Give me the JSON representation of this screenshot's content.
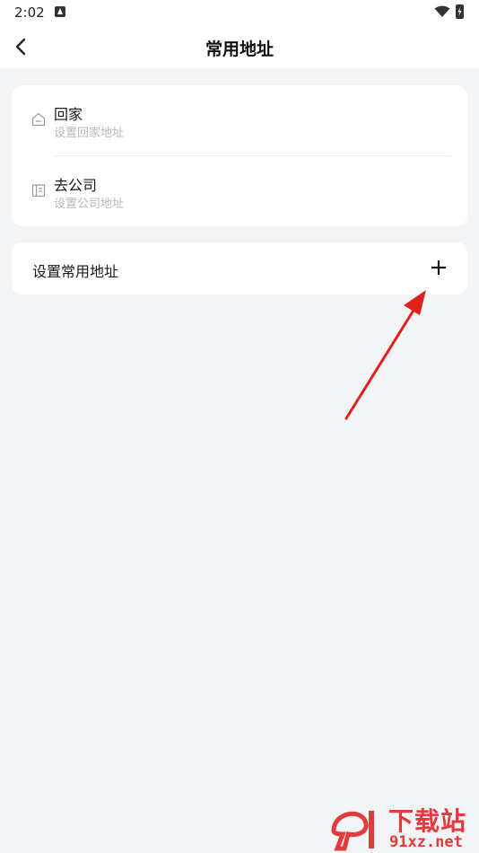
{
  "status_bar": {
    "time": "2:02",
    "notification_icon": "a-square-icon",
    "wifi_icon": "wifi-icon",
    "battery_icon": "battery-charging-icon"
  },
  "header": {
    "title": "常用地址",
    "back_icon": "chevron-left-icon"
  },
  "addresses": [
    {
      "title": "回家",
      "subtitle": "设置回家地址",
      "icon": "home-icon"
    },
    {
      "title": "去公司",
      "subtitle": "设置公司地址",
      "icon": "office-icon"
    }
  ],
  "set_common": {
    "label": "设置常用地址",
    "icon": "plus-icon"
  },
  "annotation": {
    "color": "#e0201b"
  },
  "watermark": {
    "name": "下载站",
    "url": "91xz.net",
    "color": "#e33b3b"
  },
  "colors": {
    "background": "#f3f4f6",
    "card": "#ffffff",
    "subtitle": "#b8b8b8"
  }
}
